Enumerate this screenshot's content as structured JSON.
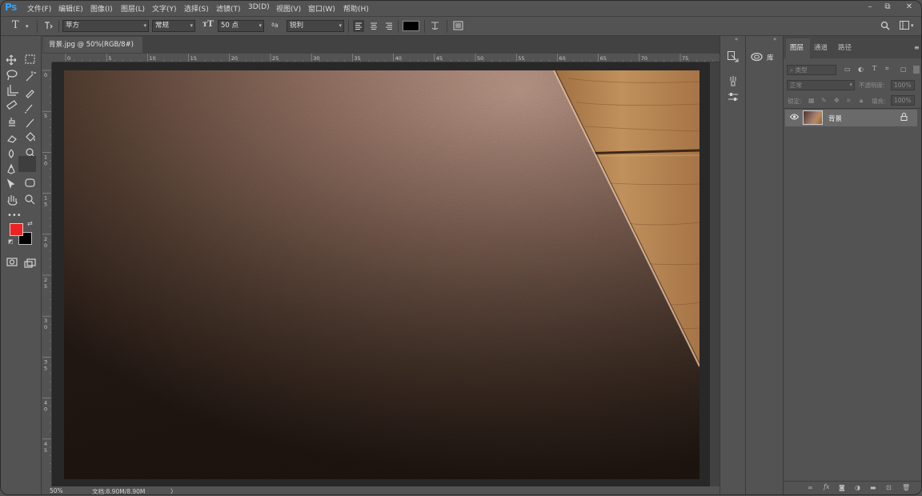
{
  "app": {
    "logo": "Ps"
  },
  "menu": [
    "文件(F)",
    "编辑(E)",
    "图像(I)",
    "图层(L)",
    "文字(Y)",
    "选择(S)",
    "滤镜(T)",
    "3D(D)",
    "视图(V)",
    "窗口(W)",
    "帮助(H)"
  ],
  "window_controls": {
    "minimize": "–",
    "restore": "⧉",
    "close": "✕"
  },
  "options": {
    "tool_glyph": "T",
    "font_family": "苹方",
    "font_style": "常规",
    "font_size": "50 点",
    "aa_prefix": "ªa",
    "anti_alias": "锐利",
    "text_color": "#000000"
  },
  "document": {
    "tab_title": "背景.jpg @ 50%(RGB/8#)",
    "tab_close": "×",
    "zoom": "50%",
    "doc_info": "文档:8.90M/8.90M",
    "status_arrow": "〉"
  },
  "ruler": {
    "h_labels": [
      "0",
      "5",
      "10",
      "15",
      "20",
      "25",
      "30",
      "35",
      "40",
      "45",
      "50",
      "55",
      "60",
      "65",
      "70",
      "75"
    ],
    "v_labels": [
      [
        "0"
      ],
      [
        "5"
      ],
      [
        "1",
        "0"
      ],
      [
        "1",
        "5"
      ],
      [
        "2",
        "0"
      ],
      [
        "2",
        "5"
      ],
      [
        "3",
        "0"
      ],
      [
        "3",
        "5"
      ],
      [
        "4",
        "0"
      ],
      [
        "4",
        "5"
      ]
    ]
  },
  "colors": {
    "foreground": "#ee2222",
    "background": "#000000"
  },
  "library": {
    "label": "库"
  },
  "layers_panel": {
    "tabs": [
      "图层",
      "通道",
      "路径"
    ],
    "filter_placeholder": "类型",
    "blend_mode": "正常",
    "opacity_label": "不透明度:",
    "opacity_value": "100%",
    "lock_label": "锁定:",
    "fill_label": "填充:",
    "fill_value": "100%",
    "layers": [
      {
        "name": "背景",
        "visible": true,
        "locked": true
      }
    ],
    "footer_icons": [
      "link-icon",
      "fx-icon",
      "mask-icon",
      "adjustment-icon",
      "group-icon",
      "new-layer-icon",
      "trash-icon"
    ]
  }
}
